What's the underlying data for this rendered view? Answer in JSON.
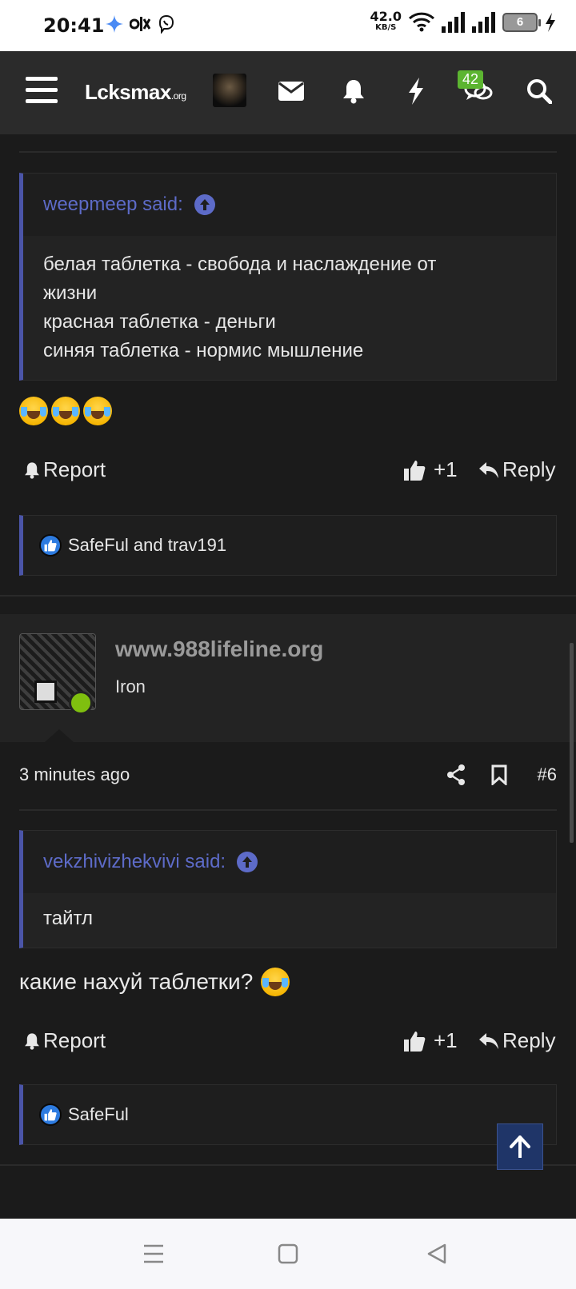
{
  "status_bar": {
    "time": "20:41",
    "net_speed": "42.0",
    "net_unit": "KB/S",
    "battery": "6",
    "icons": [
      "gemini-icon",
      "olx-icon",
      "viber-icon",
      "wifi-icon",
      "signal-icon",
      "signal-icon",
      "battery-icon",
      "charging-icon"
    ]
  },
  "header": {
    "logo": "Lcksmax",
    "logo_tld": ".org",
    "badge_count": "42",
    "icons": [
      "menu-icon",
      "mail-icon",
      "bell-icon",
      "bolt-icon",
      "chat-icon",
      "search-icon"
    ]
  },
  "post1": {
    "quote_author": "weepmeep said:",
    "quote_lines": [
      "белая таблетка - свобода и наслаждение от",
      "жизни",
      "красная таблетка - деньги",
      "синяя таблетка - нормис мышление"
    ],
    "emoji_count": 3,
    "report_label": "Report",
    "like_label": "+1",
    "reply_label": "Reply",
    "reactions": "SafeFul and trav191"
  },
  "post2": {
    "author": "www.988lifeline.org",
    "author_title": "Iron",
    "time": "3 minutes ago",
    "post_number": "#6",
    "quote_author": "vekzhivizhekvivi said:",
    "quote_text": "тайтл",
    "message": "какие нахуй таблетки?",
    "report_label": "Report",
    "like_label": "+1",
    "reply_label": "Reply",
    "reactions": "SafeFul"
  },
  "colors": {
    "accent": "#4b55a8",
    "quote_link": "#5d6bc8",
    "online": "#7fbf0f",
    "badge": "#5cb531"
  }
}
